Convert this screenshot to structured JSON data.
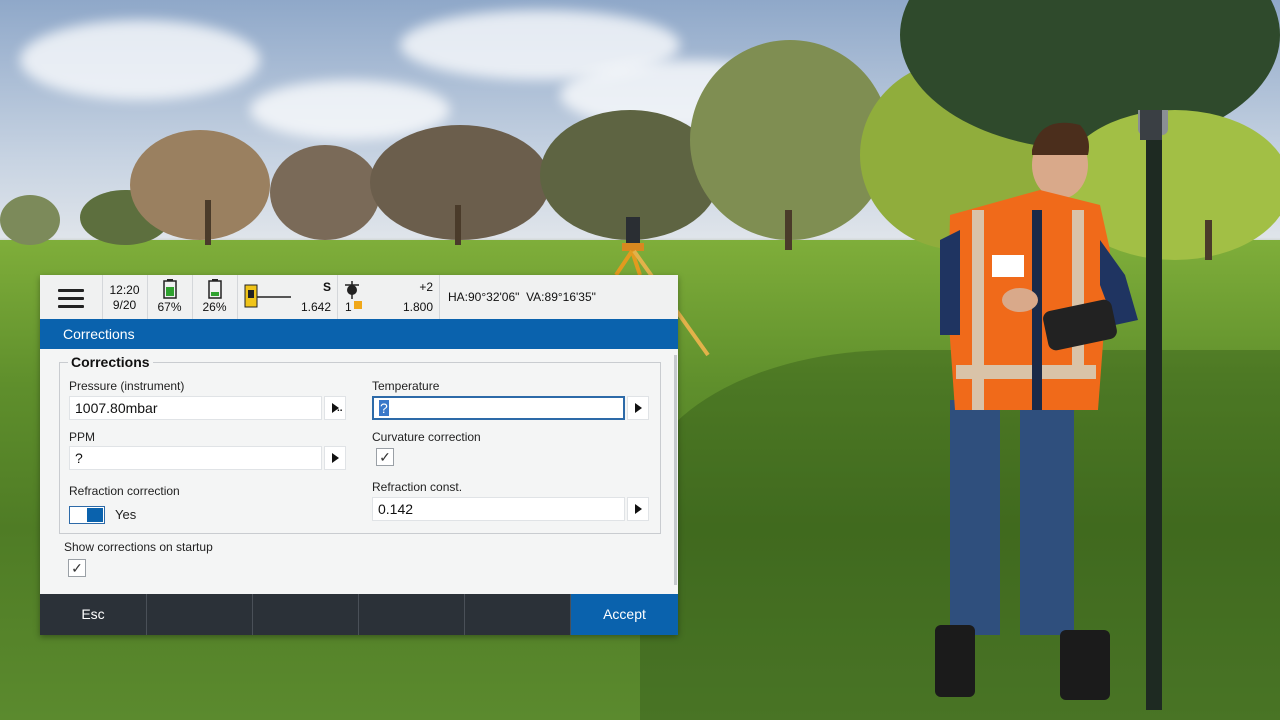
{
  "status_bar": {
    "time": "12:20",
    "date": "9/20",
    "battery_1": "67%",
    "battery_2": "26%",
    "instrument_mode": "S",
    "instrument_value": "1.642",
    "target_number": "1",
    "prism_offset": "+2",
    "target_height": "1.800",
    "angles": "HA:90°32'06\"  VA:89°16'35\"",
    "battery_1_level": 0.67,
    "battery_2_level": 0.26
  },
  "dialog": {
    "title": "Corrections",
    "group_title": "Corrections",
    "pressure": {
      "label": "Pressure (instrument)",
      "value": "1007.80mbar",
      "button_glyph": "▸..."
    },
    "temperature": {
      "label": "Temperature",
      "value": "?"
    },
    "ppm": {
      "label": "PPM",
      "value": "?"
    },
    "curvature": {
      "label": "Curvature correction",
      "checked": true,
      "mark": "✓"
    },
    "refraction": {
      "label": "Refraction correction",
      "value": "Yes",
      "on": true
    },
    "refraction_const": {
      "label": "Refraction const.",
      "value": "0.142"
    },
    "show_on_startup": {
      "label": "Show corrections on startup",
      "checked": true,
      "mark": "✓"
    }
  },
  "footer": {
    "esc_label": "Esc",
    "accept_label": "Accept"
  },
  "colors": {
    "title_bar": "#0a62ad",
    "accept_button": "#0a62ad",
    "footer": "#2b3138"
  }
}
